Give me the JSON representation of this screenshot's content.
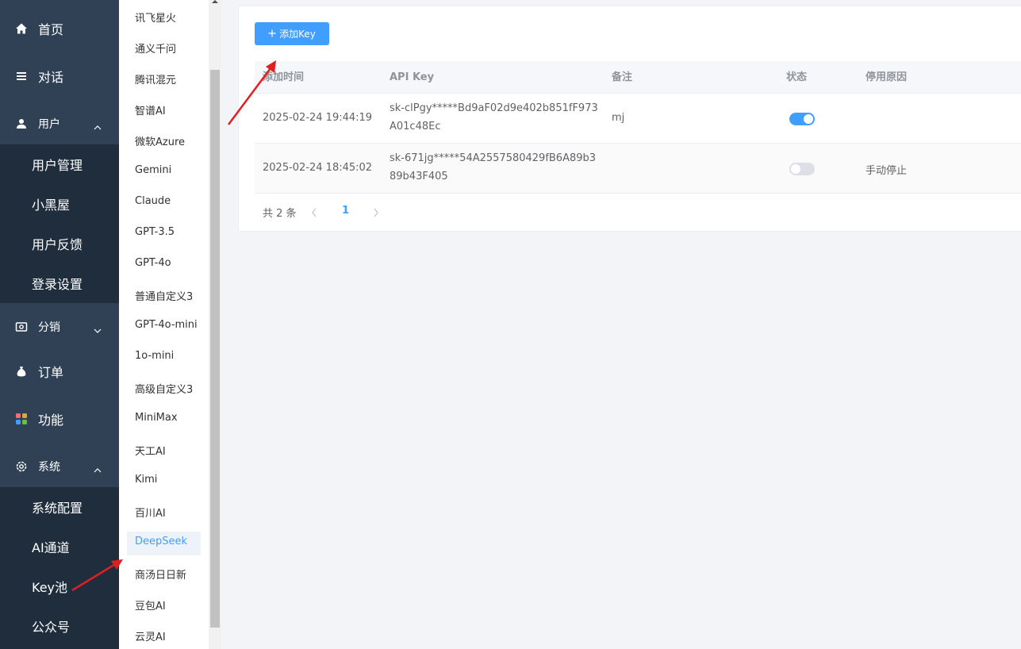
{
  "sidebar": {
    "items": [
      {
        "label": "首页",
        "icon": "home-icon"
      },
      {
        "label": "对话",
        "icon": "menu-lines-icon"
      },
      {
        "label": "用户",
        "icon": "user-icon"
      },
      {
        "label": "分销",
        "icon": "wallet-icon"
      },
      {
        "label": "订单",
        "icon": "money-bag-icon"
      },
      {
        "label": "功能",
        "icon": "grid-icon"
      },
      {
        "label": "系统",
        "icon": "gear-icon"
      }
    ],
    "user_sub": [
      "用户管理",
      "小黑屋",
      "用户反馈",
      "登录设置"
    ],
    "system_sub": [
      "系统配置",
      "AI通道",
      "Key池",
      "公众号"
    ]
  },
  "submenu": {
    "items": [
      "讯飞星火",
      "通义千问",
      "腾讯混元",
      "智谱AI",
      "微软Azure",
      "Gemini",
      "Claude",
      "GPT-3.5",
      "GPT-4o",
      "普通自定义3",
      "GPT-4o-mini",
      "1o-mini",
      "高级自定义3",
      "MiniMax",
      "天工AI",
      "Kimi",
      "百川AI",
      "DeepSeek",
      "商汤日日新",
      "豆包AI",
      "云灵AI"
    ],
    "active": "DeepSeek"
  },
  "toolbar": {
    "add_label": "添加Key",
    "add_icon": "plus-icon"
  },
  "table": {
    "headers": [
      "添加时间",
      "API Key",
      "备注",
      "状态",
      "停用原因"
    ],
    "rows": [
      {
        "time": "2025-02-24 19:44:19",
        "key": "sk-clPgy*****Bd9aF02d9e402b851fF973A01c48Ec",
        "note": "mj",
        "enabled": true,
        "reason": ""
      },
      {
        "time": "2025-02-24 18:45:02",
        "key": "sk-671jg*****54A2557580429fB6A89b389b43F405",
        "note": "",
        "enabled": false,
        "reason": "手动停止"
      }
    ]
  },
  "pagination": {
    "total_label": "共 2 条",
    "current_page": "1"
  },
  "colors": {
    "sidebar_bg": "#304156",
    "submenu_open_bg": "#1f2d3d",
    "accent": "#409eff",
    "arrow": "#e02020"
  }
}
